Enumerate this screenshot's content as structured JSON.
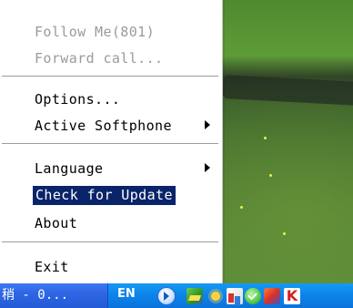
{
  "menu": {
    "items": [
      {
        "label": "Follow Me(801)",
        "disabled": true
      },
      {
        "label": "Forward call...",
        "disabled": true
      },
      {
        "label": "Options...",
        "disabled": false
      },
      {
        "label": "Active Softphone",
        "disabled": false,
        "submenu": true
      },
      {
        "label": "Language",
        "disabled": false,
        "submenu": true
      },
      {
        "label": "Check for Update",
        "disabled": false,
        "selected": true
      },
      {
        "label": "About",
        "disabled": false
      },
      {
        "label": "Exit",
        "disabled": false
      }
    ]
  },
  "taskbar": {
    "task_button_label": "稍 - 0...",
    "language_indicator": "EN",
    "tray_icons": [
      "expand-arrow-icon",
      "network-icon",
      "sun-icon",
      "chart-icon",
      "shield-check-icon",
      "puzzle-icon",
      "k-logo-icon"
    ],
    "k_logo_text": "K"
  },
  "colors": {
    "menu_selection": "#0a246a",
    "menu_disabled_text": "#9a9a9a",
    "taskbar_blue": "#2f66e3",
    "tray_blue": "#0d84ea"
  }
}
